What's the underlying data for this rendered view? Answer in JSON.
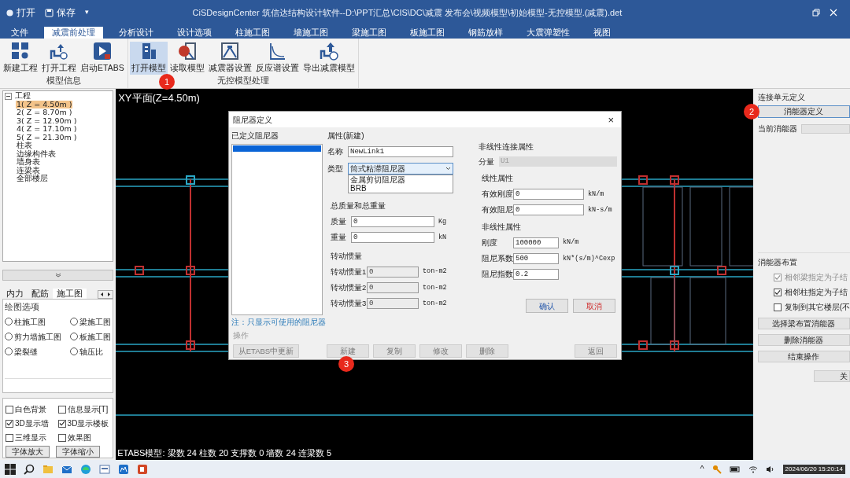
{
  "quick_access": {
    "open": "打开",
    "save": "保存",
    "dropdown": "▾"
  },
  "window": {
    "title": "CiSDesignCenter 筑信达结构设计软件--D:\\PPT汇总\\CIS\\DC\\减震 发布会\\视频模型\\初始模型-无控模型.(减震).det"
  },
  "menu_tabs": [
    {
      "label": "文件",
      "selected": false
    },
    {
      "label": "减震前处理",
      "selected": true
    },
    {
      "label": "分析设计",
      "selected": false
    },
    {
      "label": "设计选项",
      "selected": false
    },
    {
      "label": "柱施工图",
      "selected": false
    },
    {
      "label": "墙施工图",
      "selected": false
    },
    {
      "label": "梁施工图",
      "selected": false
    },
    {
      "label": "板施工图",
      "selected": false
    },
    {
      "label": "钢筋放样",
      "selected": false
    },
    {
      "label": "大震弹塑性",
      "selected": false
    },
    {
      "label": "视图",
      "selected": false
    }
  ],
  "ribbon_groups": [
    {
      "label": "模型信息",
      "items": [
        {
          "label": "新建工程",
          "selected": false
        },
        {
          "label": "打开工程",
          "selected": false
        },
        {
          "label": "启动ETABS",
          "selected": false
        }
      ]
    },
    {
      "label": "无控模型处理",
      "items": [
        {
          "label": "打开模型",
          "selected": true
        },
        {
          "label": "读取模型",
          "selected": false
        },
        {
          "label": "减震器设置",
          "selected": false
        },
        {
          "label": "反应谱设置",
          "selected": false
        },
        {
          "label": "导出减震模型",
          "selected": false
        }
      ]
    }
  ],
  "tree": [
    {
      "label": "工程",
      "expanded": true,
      "children": [
        {
          "label": "1( Z = 4.50m )",
          "selected": true
        },
        {
          "label": "2( Z = 8.70m )",
          "selected": false
        },
        {
          "label": "3( Z = 12.90m )",
          "selected": false
        },
        {
          "label": "4( Z = 17.10m )",
          "selected": false
        },
        {
          "label": "5( Z = 21.30m )",
          "selected": false
        },
        {
          "label": "柱表",
          "selected": false
        },
        {
          "label": "边缘构件表",
          "selected": false
        },
        {
          "label": "墙身表",
          "selected": false
        },
        {
          "label": "连梁表",
          "selected": false
        },
        {
          "label": "全部楼层",
          "selected": false
        }
      ]
    }
  ],
  "panel_tabs": [
    {
      "label": "内力",
      "selected": false
    },
    {
      "label": "配筋",
      "selected": false
    },
    {
      "label": "施工图",
      "selected": true
    }
  ],
  "drawing_options": {
    "title": "绘图选项",
    "options": [
      {
        "label": "柱施工图",
        "selected": false
      },
      {
        "label": "梁施工图",
        "selected": false
      },
      {
        "label": "剪力墙施工图",
        "selected": false
      },
      {
        "label": "板施工图",
        "selected": false
      },
      {
        "label": "梁裂缝",
        "selected": false
      },
      {
        "label": "轴压比",
        "selected": false
      }
    ]
  },
  "display_checks": [
    {
      "label": "白色背景",
      "checked": false
    },
    {
      "label": "信息显示[T]",
      "checked": false
    },
    {
      "label": "3D显示墙",
      "checked": true
    },
    {
      "label": "3D显示楼板",
      "checked": true
    },
    {
      "label": "三维显示",
      "checked": false
    },
    {
      "label": "效果图",
      "checked": false
    }
  ],
  "font_buttons": [
    "字体放大",
    "字体缩小"
  ],
  "canvas": {
    "view_label": "XY平面(Z=4.50m)",
    "status": "ETABS模型: 梁数 24 柱数 20 支撑数 0 墙数 24 连梁数 5"
  },
  "dialog": {
    "title": "阻尼器定义",
    "close": "×",
    "defined_title": "已定义阻尼器",
    "defined_list": [
      {
        "selected": true
      }
    ],
    "note": "注：只显示可使用的阻尼器",
    "props_title": "属性(新建)",
    "name_label": "名称",
    "name_value": "NewLink1",
    "type_label": "类型",
    "type_value": "筒式粘滞阻尼器",
    "type_options": [
      "金属剪切阻尼器",
      "BRB"
    ],
    "mass_group": "总质量和总重量",
    "mass_fields": [
      {
        "label": "质量",
        "value": "0",
        "unit": "Kg",
        "disabled": false
      },
      {
        "label": "重量",
        "value": "0",
        "unit": "kN",
        "disabled": false
      }
    ],
    "inertia_group": "转动惯量",
    "inertia_fields": [
      {
        "label": "转动惯量1",
        "value": "0",
        "unit": "ton-m2",
        "disabled": true
      },
      {
        "label": "转动惯量2",
        "value": "0",
        "unit": "ton-m2",
        "disabled": true
      },
      {
        "label": "转动惯量3",
        "value": "0",
        "unit": "ton-m2",
        "disabled": true
      }
    ],
    "nonlinear_title": "非线性连接属性",
    "component_label": "分量",
    "component_value": "U1",
    "linear_group": "线性属性",
    "linear_fields": [
      {
        "label": "有效刚度",
        "value": "0",
        "unit": "kN/m",
        "disabled": false
      },
      {
        "label": "有效阻尼",
        "value": "0",
        "unit": "kN-s/m",
        "disabled": false
      }
    ],
    "nl_group": "非线性属性",
    "nl_fields": [
      {
        "label": "刚度",
        "value": "100000",
        "unit": "kN/m",
        "disabled": false
      },
      {
        "label": "阻尼系数",
        "value": "500",
        "unit": "kN*(s/m)^Cexp",
        "disabled": false
      },
      {
        "label": "阻尼指数",
        "value": "0.2",
        "disabled": false
      }
    ],
    "confirm": "确认",
    "cancel": "取消",
    "ops_label": "操作",
    "ops_buttons": [
      {
        "label": "从ETABS中更新",
        "disabled": true
      },
      {
        "label": "新建",
        "disabled": true
      },
      {
        "label": "复制",
        "disabled": true
      },
      {
        "label": "修改",
        "disabled": true
      },
      {
        "label": "删除",
        "disabled": true
      },
      {
        "label": "返回",
        "disabled": true
      }
    ]
  },
  "right_panel": {
    "link_title": "连接单元定义",
    "define_button": "消能器定义",
    "current_label": "当前消能器",
    "layout_title": "消能器布置",
    "checks": [
      {
        "label": "相邻梁指定为子结",
        "checked": true,
        "disabled": true
      },
      {
        "label": "相邻柱指定为子结",
        "checked": true,
        "disabled": false
      },
      {
        "label": "复制到其它楼层(不",
        "checked": false,
        "disabled": false
      }
    ],
    "buttons": [
      "选择梁布置消能器",
      "删除消能器",
      "结束操作"
    ],
    "close_button": "关"
  },
  "callouts": [
    "1",
    "2",
    "3"
  ],
  "taskbar": {
    "tray_arrow": "^",
    "clock": "2024/06/20 15:20:14"
  }
}
